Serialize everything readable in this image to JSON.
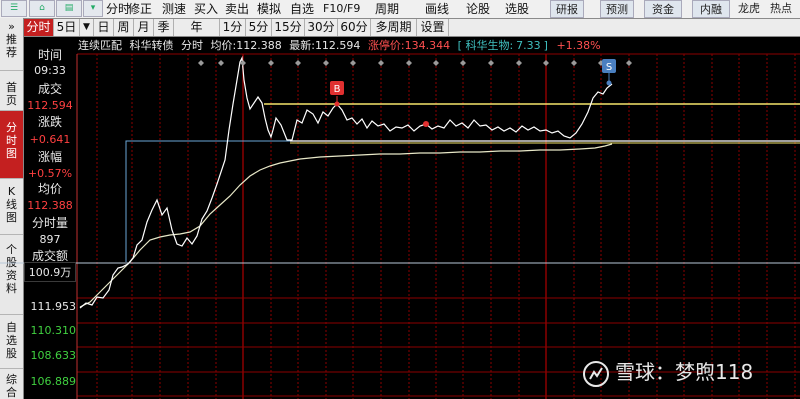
{
  "toolbar": {
    "items": [
      "分时",
      "修正",
      "测速",
      "买入",
      "卖出",
      "模拟",
      "自选",
      "F10/F9",
      "周期",
      "画线",
      "论股",
      "选股"
    ],
    "right_buttons": [
      "研报",
      "预测",
      "资金",
      "内融",
      "龙虎",
      "热点"
    ]
  },
  "period_tabs": [
    "分时",
    "5日",
    "▼",
    "日",
    "周",
    "月",
    "季",
    "年",
    "1分",
    "5分",
    "15分",
    "30分",
    "60分",
    "多周期",
    "设置"
  ],
  "sidebar": {
    "tabs": [
      {
        "label": "推荐",
        "top": "»"
      },
      {
        "label": "首页"
      },
      {
        "label": "分时图"
      },
      {
        "label": "K线图"
      },
      {
        "label": "个股资料"
      },
      {
        "label": "自选股"
      },
      {
        "label": "综合排"
      }
    ]
  },
  "info": {
    "time_label": "时间",
    "time_value": "09:33",
    "trade_label": "成交",
    "trade_value": "112.594",
    "change_label": "涨跌",
    "change_value": "+0.641",
    "pct_label": "涨幅",
    "pct_value": "+0.57%",
    "avg_label": "均价",
    "avg_value": "112.388",
    "vol_label": "分时量",
    "vol_value": "897",
    "amount_label": "成交额",
    "amount_value": "100.9万"
  },
  "header": {
    "mode": "连续匹配",
    "name": "科华转债",
    "view": "分时",
    "avg_label": "均价:",
    "avg_value": "112.388",
    "last_label": "最新:",
    "last_value": "112.594",
    "limit_label": "涨停价:",
    "limit_value": "134.344",
    "related_label": "[ 科华生物:",
    "related_value": "7.33",
    "related_close": "]",
    "related_change": "+1.38%"
  },
  "axis": {
    "labels": [
      "111.953",
      "110.310",
      "108.633",
      "106.889"
    ],
    "colors": [
      "#e8e8e8",
      "#40d040",
      "#40d040",
      "#40d040"
    ]
  },
  "markers": {
    "buy": "B",
    "sell": "S"
  },
  "watermark": "雪球：梦煦118",
  "colors": {
    "price_line": "#ffffff",
    "avg_line": "#e8e8c8",
    "up": "#ff4040",
    "down": "#40d040",
    "grid": "#8b0000",
    "level_line": "#f5e66a",
    "marker_b": "#e03030",
    "marker_s": "#4a7fc0",
    "header_red": "#ff5050",
    "header_cyan": "#40c0c0"
  }
}
